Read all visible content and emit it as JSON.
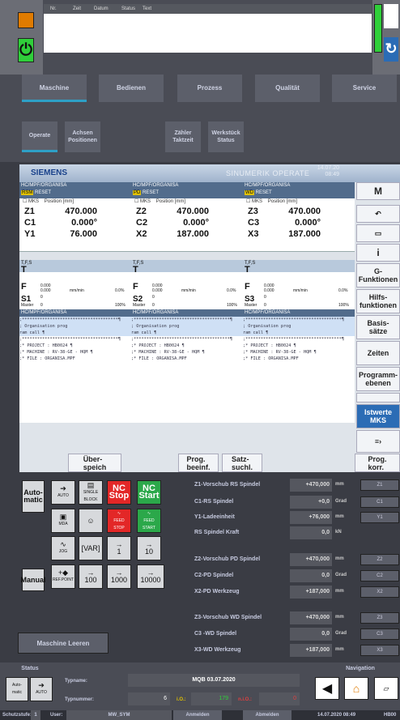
{
  "alarm_header": {
    "nr": "Nr.",
    "zeit": "Zeit",
    "datum": "Datum",
    "status": "Status",
    "text": "Text"
  },
  "nav": [
    "Maschine",
    "Bedienen",
    "Prozess",
    "Qualität",
    "Service"
  ],
  "subnav": [
    "Operate",
    "Achsen Positionen",
    "Zähler Taktzeit",
    "Werkstück Status"
  ],
  "hmi": {
    "logo": "SIEMENS",
    "product": "SINUMERIK OPERATE",
    "date": "14.07.20",
    "time": "08:49",
    "channels": [
      {
        "path": "HC/MPF/ORGANISA",
        "mode": "RSM",
        "state": "RESET",
        "mks": "MKS",
        "pos_hdr": "Position [mm]",
        "axes": [
          {
            "n": "Z1",
            "v": "470.000"
          },
          {
            "n": "C1",
            "v": "0.000°"
          },
          {
            "n": "Y1",
            "v": "76.000"
          }
        ],
        "tool": "T,F,S",
        "t": "T",
        "f1": "0.000",
        "f2": "0.000",
        "funit": "mm/min",
        "fpct": "0.0%",
        "s": "S1",
        "s1": "0",
        "s2": "0",
        "spct": "100%",
        "master": "Master"
      },
      {
        "path": "HC/MPF/ORGANISA",
        "mode": "PD",
        "state": "RESET",
        "mks": "MKS",
        "pos_hdr": "Position [mm]",
        "axes": [
          {
            "n": "Z2",
            "v": "470.000"
          },
          {
            "n": "C2",
            "v": "0.000°"
          },
          {
            "n": "X2",
            "v": "187.000"
          }
        ],
        "tool": "T,F,S",
        "t": "T",
        "f1": "0.000",
        "f2": "0.000",
        "funit": "mm/min",
        "fpct": "0.0%",
        "s": "S2",
        "s1": "0",
        "s2": "0",
        "spct": "100%",
        "master": "Master"
      },
      {
        "path": "HC/MPF/ORGANISA",
        "mode": "WD",
        "state": "RESET",
        "mks": "MKS",
        "pos_hdr": "Position [mm]",
        "axes": [
          {
            "n": "Z3",
            "v": "470.000"
          },
          {
            "n": "C3",
            "v": "0.000°"
          },
          {
            "n": "X3",
            "v": "187.000"
          }
        ],
        "tool": "T,F,S",
        "t": "T",
        "f1": "0.000",
        "f2": "0.000",
        "funit": "mm/min",
        "fpct": "0.0%",
        "s": "S3",
        "s1": "0",
        "s2": "0",
        "spct": "100%",
        "master": "Master"
      }
    ],
    "prog_lines": [
      ";**************************************¶",
      "; Organisation prog",
      "ram call ¶",
      ";**************************************¶",
      ";* PROJECT : HB0024 ¶",
      ";* MACHINE : RV-38-GE - HQM ¶",
      ";* FILE : ORGANISA.MPF"
    ],
    "right_keys": [
      "G-\nFunktionen",
      "Hilfs-\nfunktionen",
      "Basis-\nsätze",
      "Zeiten",
      "Programm-\nebenen",
      "Istwerte\nMKS"
    ],
    "bottom_keys": [
      "Über-\nspeich",
      "Prog.\nbeeinf.",
      "Satz-\nsuchl.",
      "Prog.\nkorr."
    ],
    "auto_label": "AUTO"
  },
  "mcp": {
    "auto": "Auto-\nmatic",
    "manual": "Manual",
    "keys": {
      "auto": "AUTO",
      "single": "SINGLE\nBLOCK",
      "ncstop": "NC\nStop",
      "ncstart": "NC\nStart",
      "mda": "MDA",
      "feedstop": "FEED\nSTOP",
      "feedstart": "FEED\nSTART",
      "jog": "JOG",
      "var": "[VAR]",
      "k1": "1",
      "k10": "10",
      "refpoint": "REF.POINT",
      "k100": "100",
      "k1000": "1000",
      "k10000": "10000"
    },
    "rows": [
      {
        "lbl": "Z1-Vorschub RS Spindel",
        "val": "+470,000",
        "unit": "mm",
        "btn": "Z1"
      },
      {
        "lbl": "C1-RS Spindel",
        "val": "+0,0",
        "unit": "Grad",
        "btn": "C1"
      },
      {
        "lbl": "Y1-Ladeeinheit",
        "val": "+76,000",
        "unit": "mm",
        "btn": "Y1"
      },
      {
        "lbl": "RS Spindel Kraft",
        "val": "0,0",
        "unit": "kN",
        "btn": ""
      },
      {
        "lbl": "Z2-Vorschub PD Spindel",
        "val": "+470,000",
        "unit": "mm",
        "btn": "Z2"
      },
      {
        "lbl": "C2-PD Spindel",
        "val": "0,0",
        "unit": "Grad",
        "btn": "C2"
      },
      {
        "lbl": "X2-PD Werkzeug",
        "val": "+187,000",
        "unit": "mm",
        "btn": "X2"
      },
      {
        "lbl": "Z3-Vorschub WD Spindel",
        "val": "+470,000",
        "unit": "mm",
        "btn": "Z3"
      },
      {
        "lbl": "C3 -WD Spindel",
        "val": "0,0",
        "unit": "Grad",
        "btn": "C3"
      },
      {
        "lbl": "X3-WD Werkzeug",
        "val": "+187,000",
        "unit": "mm",
        "btn": "X3"
      }
    ],
    "leeren": "Maschine Leeren"
  },
  "status": {
    "title": "Status",
    "auto": "Auto-\nmatic",
    "auto2": "AUTO",
    "typname_lbl": "Typname:",
    "typname": "MQB 03.07.2020",
    "typnummer_lbl": "Typnummer:",
    "typnummer": "6",
    "io_lbl": "i.O.:",
    "io": "179",
    "nio_lbl": "n.i.O.:",
    "nio": "0",
    "navigation": "Navigation",
    "schutz_lbl": "Schutzstufe:",
    "schutz": "1",
    "user_lbl": "User:",
    "user": "MW_SYM",
    "login": "Anmelden",
    "logout": "Abmelden",
    "datetime": "14.07.2020 08:49",
    "code": "HB00"
  }
}
